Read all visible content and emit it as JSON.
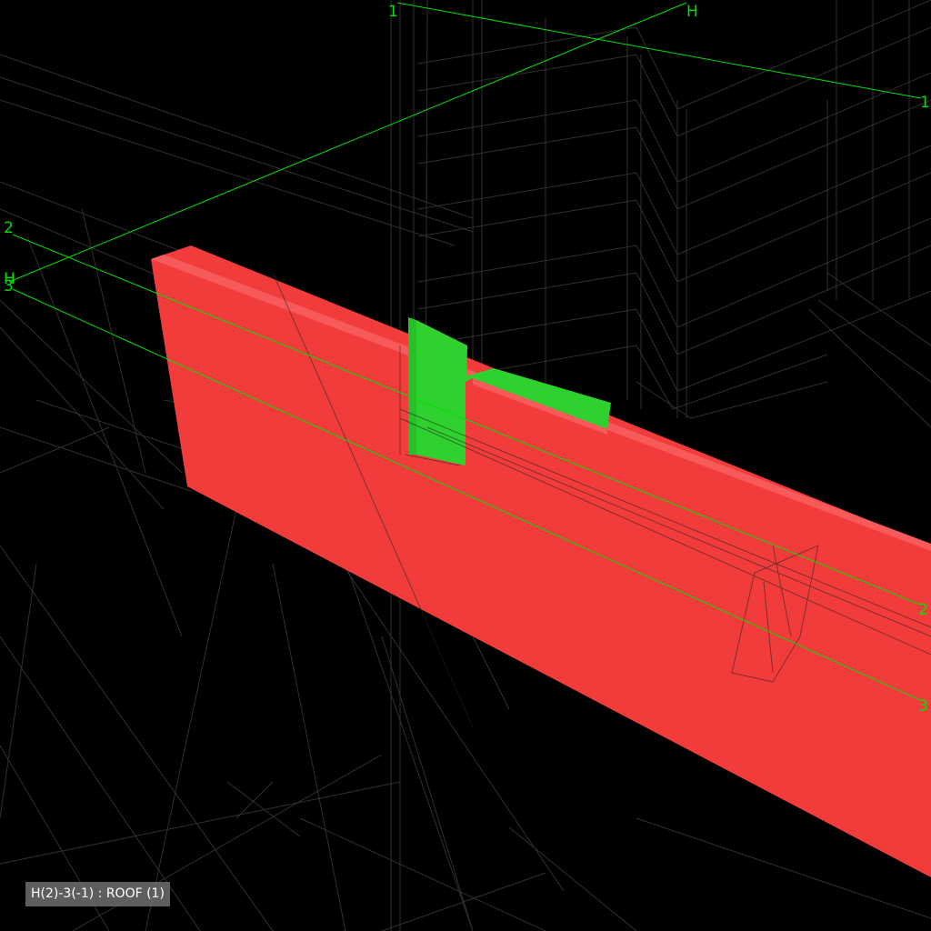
{
  "colors": {
    "background": "#000000",
    "wireframe": "#8a8a8a",
    "grid_line": "#00e000",
    "grid_label": "#00e000",
    "clash_element_a": "#f23c3c",
    "clash_element_b": "#2fd12f",
    "status_background": "#6e6e6e",
    "status_text": "#ffffff"
  },
  "gridlines": [
    {
      "id": "1",
      "start_label": "1",
      "end_label": "1"
    },
    {
      "id": "H",
      "start_label": "H",
      "end_label": "H"
    },
    {
      "id": "2",
      "start_label": "2",
      "end_label": "2"
    },
    {
      "id": "3",
      "start_label": "3",
      "end_label": "3"
    }
  ],
  "elements": {
    "red_element": {
      "role": "clash element",
      "color": "#f23c3c"
    },
    "green_element": {
      "role": "clash element",
      "color": "#2fd12f"
    }
  },
  "status": {
    "location_text": "H(2)-3(-1) : ROOF (1)"
  }
}
